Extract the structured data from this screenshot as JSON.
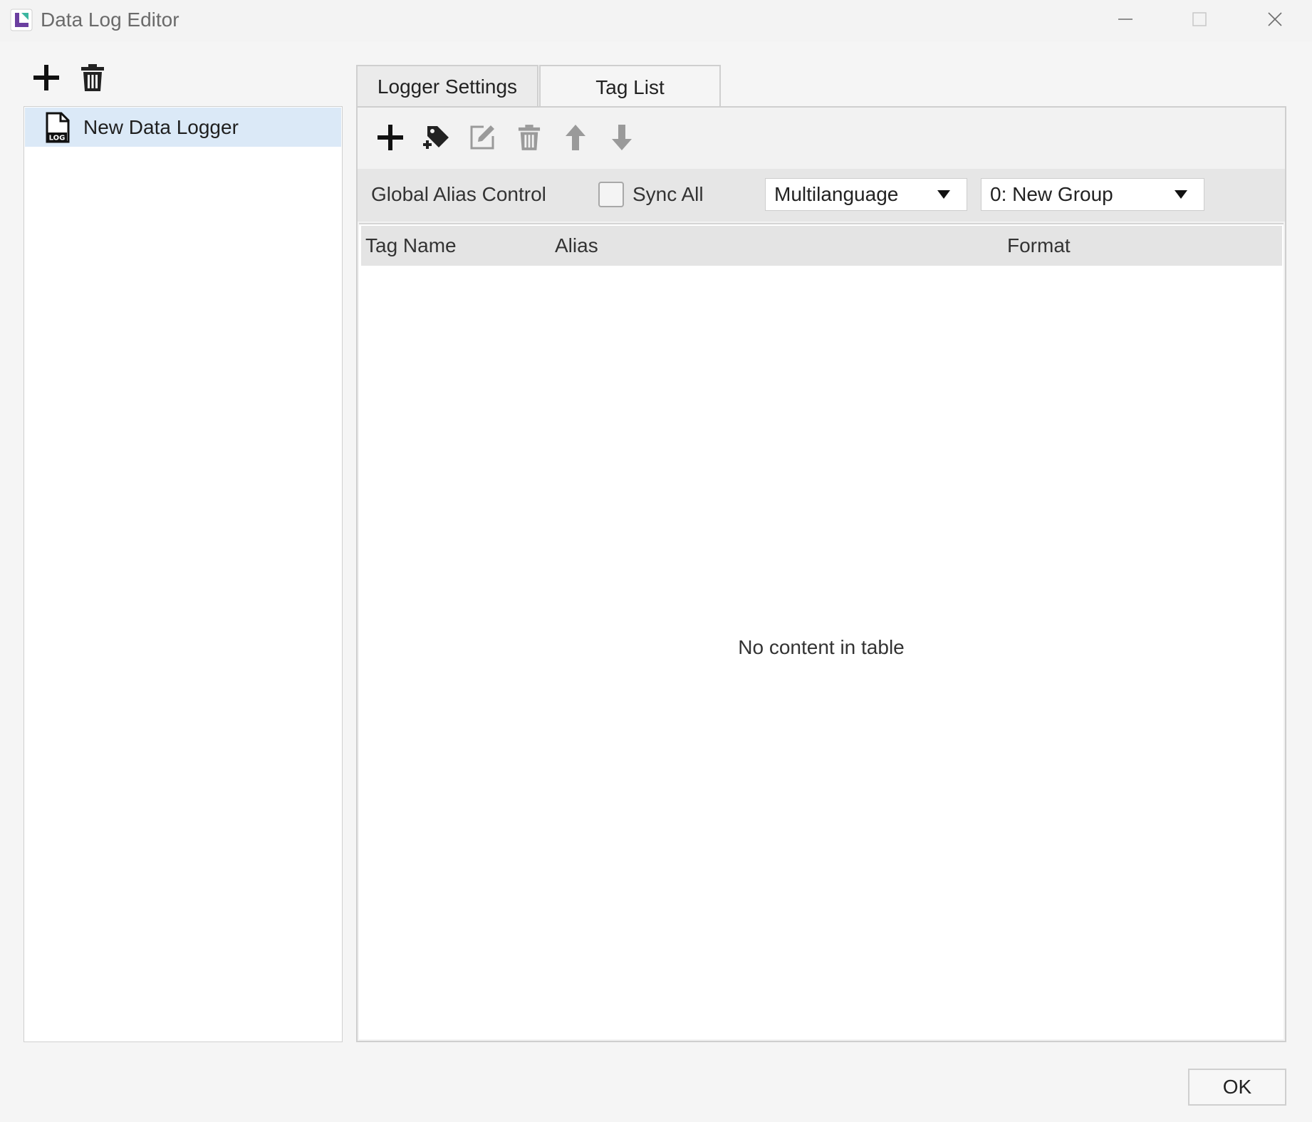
{
  "window": {
    "title": "Data Log Editor"
  },
  "left_panel": {
    "toolbar": {
      "add_icon": "plus-icon",
      "delete_icon": "trash-icon"
    },
    "items": [
      {
        "label": "New Data Logger",
        "icon": "log-file-icon",
        "selected": true
      }
    ]
  },
  "tabs": [
    {
      "label": "Logger Settings",
      "active": false
    },
    {
      "label": "Tag List",
      "active": true
    }
  ],
  "tag_list": {
    "toolbar": {
      "icons": [
        "plus-icon",
        "add-tag-icon",
        "edit-icon",
        "trash-icon",
        "arrow-up-icon",
        "arrow-down-icon"
      ]
    },
    "alias_control": {
      "label": "Global Alias Control",
      "sync_all_label": "Sync All",
      "sync_all_checked": false,
      "language_select": "Multilanguage",
      "group_select": "0: New Group"
    },
    "table": {
      "columns": [
        "Tag Name",
        "Alias",
        "Format"
      ],
      "rows": [],
      "empty_message": "No content in table"
    }
  },
  "footer": {
    "ok_label": "OK"
  },
  "colors": {
    "selection": "#dbe9f7",
    "disabled_icon": "#9a9a9a",
    "header_bg": "#e4e4e4"
  }
}
